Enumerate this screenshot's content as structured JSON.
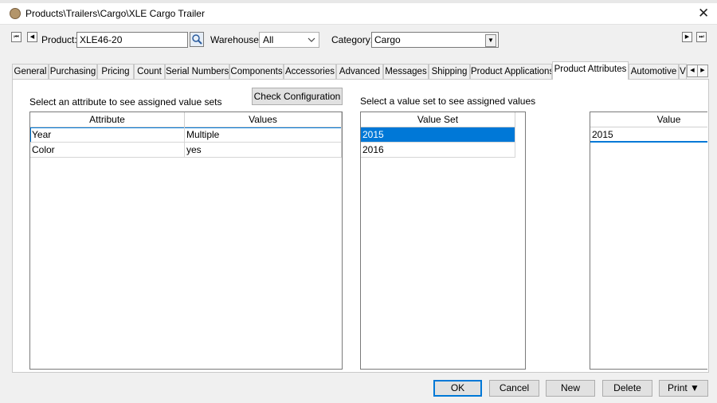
{
  "window": {
    "title": "Products\\Trailers\\Cargo\\XLE Cargo Trailer",
    "close_glyph": "✕"
  },
  "header": {
    "nav_first": "⏮",
    "nav_prev": "◀",
    "nav_next": "▶",
    "nav_last": "⏭",
    "product_label": "Product:",
    "product_value": "XLE46-20",
    "warehouse_label": "Warehouse:",
    "warehouse_value": "All",
    "category_label": "Category:",
    "category_value": "Cargo"
  },
  "tabs": [
    {
      "label": "General"
    },
    {
      "label": "Purchasing"
    },
    {
      "label": "Pricing"
    },
    {
      "label": "Count"
    },
    {
      "label": "Serial Numbers"
    },
    {
      "label": "Components"
    },
    {
      "label": "Accessories"
    },
    {
      "label": "Advanced"
    },
    {
      "label": "Messages"
    },
    {
      "label": "Shipping"
    },
    {
      "label": "Product Applications"
    },
    {
      "label": "Product Attributes"
    },
    {
      "label": "Automotive"
    },
    {
      "label": "V"
    }
  ],
  "active_tab": "Product Attributes",
  "attributes": {
    "hint": "Select an attribute to see assigned value sets",
    "check_button": "Check Configuration",
    "columns": [
      "Attribute",
      "Values"
    ],
    "rows": [
      {
        "attribute": "Year",
        "values": "Multiple"
      },
      {
        "attribute": "Color",
        "values": "yes"
      }
    ]
  },
  "value_sets": {
    "hint": "Select a value set to see assigned values",
    "column": "Value Set",
    "rows": [
      "2015",
      "2016"
    ]
  },
  "values": {
    "column": "Value",
    "rows": [
      "2015"
    ]
  },
  "buttons": {
    "ok": "OK",
    "cancel": "Cancel",
    "new": "New",
    "delete": "Delete",
    "print": "Print ▼"
  },
  "colors": {
    "selection": "#0078d7",
    "title_icon": "#b3956a"
  },
  "icons": {
    "search": "magnifier-icon",
    "dropdown": "chevron-down-icon",
    "title": "product-icon"
  }
}
